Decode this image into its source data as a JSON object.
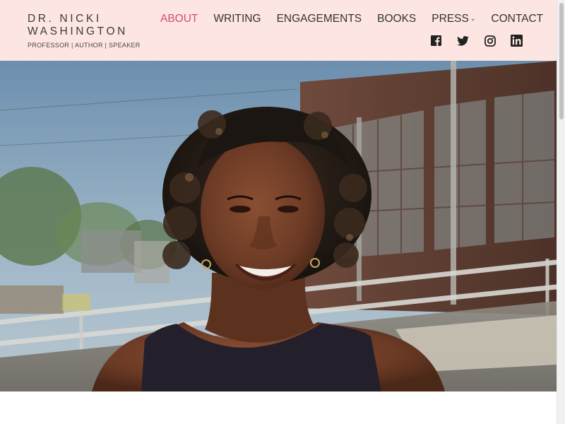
{
  "site": {
    "name": "DR. NICKI WASHINGTON",
    "tagline": "PROFESSOR | AUTHOR | SPEAKER"
  },
  "nav": {
    "items": [
      {
        "label": "ABOUT",
        "active": true
      },
      {
        "label": "WRITING"
      },
      {
        "label": "ENGAGEMENTS"
      },
      {
        "label": "BOOKS"
      },
      {
        "label": "PRESS",
        "has_dropdown": true
      },
      {
        "label": "CONTACT"
      }
    ],
    "dropdown_caret": "⌄"
  },
  "social": [
    {
      "icon": "facebook-icon"
    },
    {
      "icon": "twitter-icon"
    },
    {
      "icon": "instagram-icon"
    },
    {
      "icon": "linkedin-icon"
    }
  ],
  "colors": {
    "header_bg": "#fde6e1",
    "accent": "#d14c74",
    "text": "#333333"
  }
}
